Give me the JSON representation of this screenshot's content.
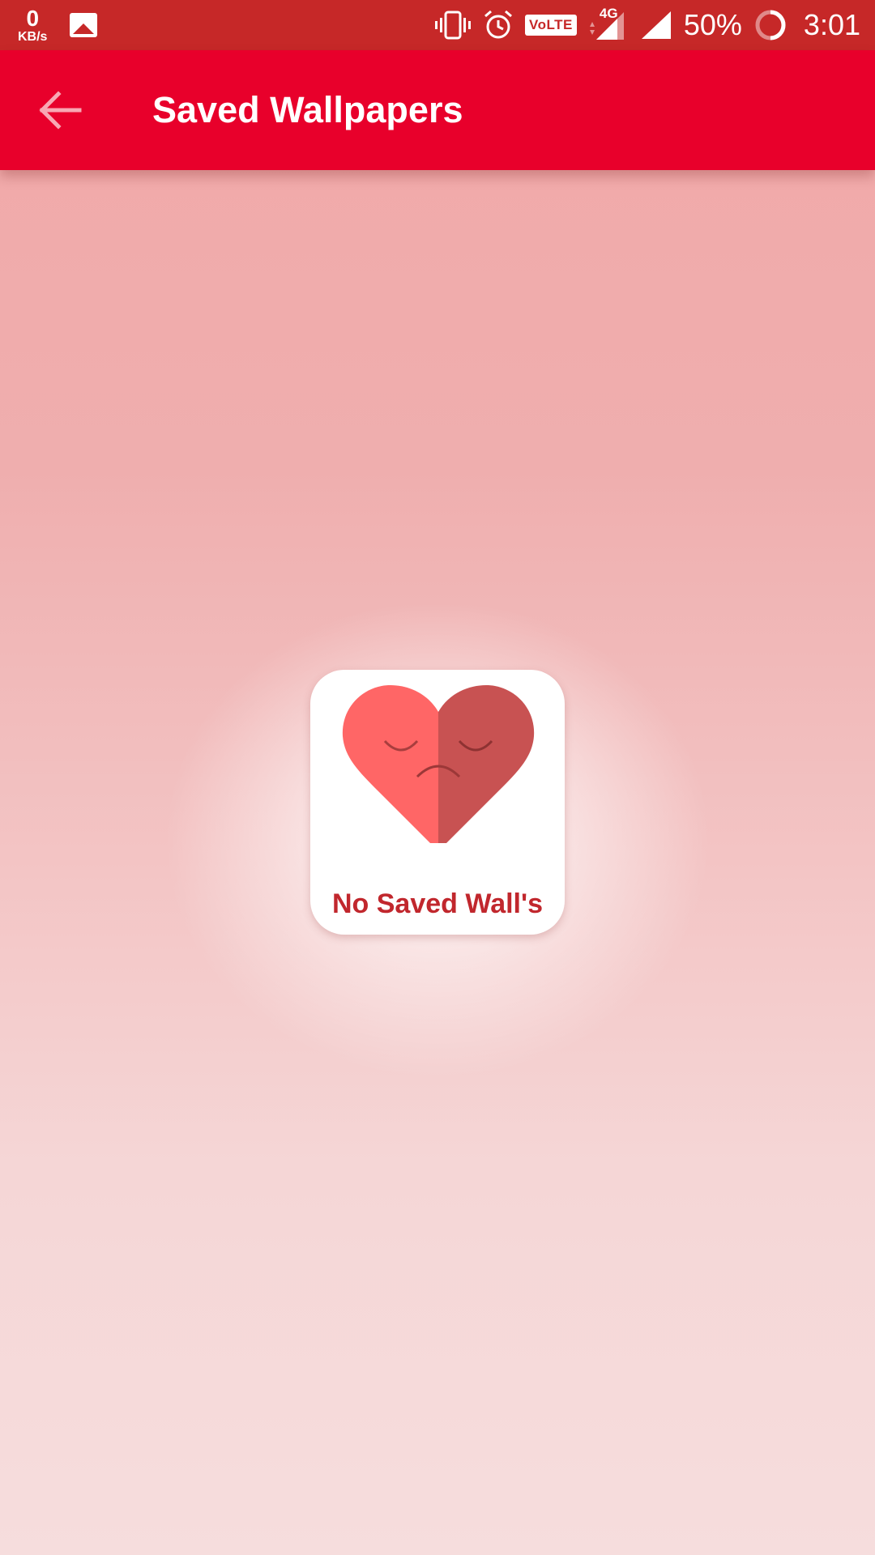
{
  "status_bar": {
    "net_speed_value": "0",
    "net_speed_unit": "KB/s",
    "volte_label": "VoLTE",
    "network_type": "4G",
    "battery_percent": "50%",
    "time": "3:01",
    "icons": [
      "vibrate-icon",
      "alarm-icon",
      "volte-icon",
      "signal-4g-icon",
      "signal-icon",
      "battery-icon",
      "gallery-icon"
    ]
  },
  "toolbar": {
    "title": "Saved Wallpapers",
    "background_color": "#e8002b",
    "back_icon": "arrow-back-icon"
  },
  "empty_state": {
    "label": "No Saved Wall's",
    "icon": "sad-heart-icon",
    "heart_left_color": "#ff6666",
    "heart_right_color": "#c85252",
    "label_color": "#c1272d"
  },
  "colors": {
    "status_bar": "#c62828"
  }
}
